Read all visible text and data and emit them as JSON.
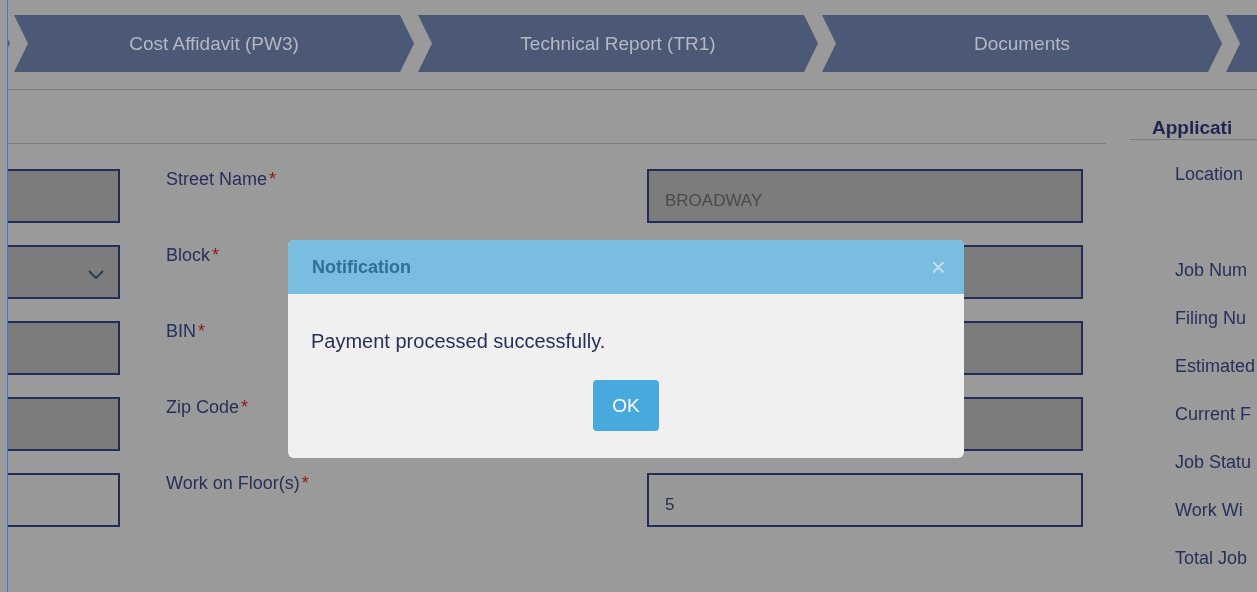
{
  "steps": [
    {
      "label": "Cost Affidavit (PW3)"
    },
    {
      "label": "Technical Report (TR1)"
    },
    {
      "label": "Documents"
    }
  ],
  "form_rows": [
    {
      "label": "Street Name",
      "required": "*",
      "left_field": {
        "kind": "input",
        "disabled": true
      },
      "right_field": {
        "value": "BROADWAY",
        "disabled": true
      }
    },
    {
      "label": "Block",
      "required": "*",
      "left_field": {
        "kind": "select",
        "disabled": true
      },
      "right_field": {
        "disabled": true
      }
    },
    {
      "label": "BIN",
      "required": "*",
      "left_field": {
        "kind": "input",
        "disabled": true
      },
      "right_field": {
        "disabled": true
      }
    },
    {
      "label": "Zip Code",
      "required": "*",
      "left_field": {
        "kind": "input",
        "disabled": true
      },
      "right_field": {
        "disabled": true
      }
    },
    {
      "label": "Work on Floor(s)",
      "required": "*",
      "left_field": {
        "kind": "input",
        "disabled": false
      },
      "right_field": {
        "value": "5",
        "disabled": false
      }
    }
  ],
  "side_panel": {
    "title": "Applicati",
    "labels": [
      "Location",
      "Job Num",
      "Filing Nu",
      "Estimated",
      "Current F",
      "Job Statu",
      "Work Wi",
      "Total Job"
    ]
  },
  "dialog": {
    "title": "Notification",
    "close": "×",
    "message": "Payment processed successfully.",
    "button": "OK"
  }
}
